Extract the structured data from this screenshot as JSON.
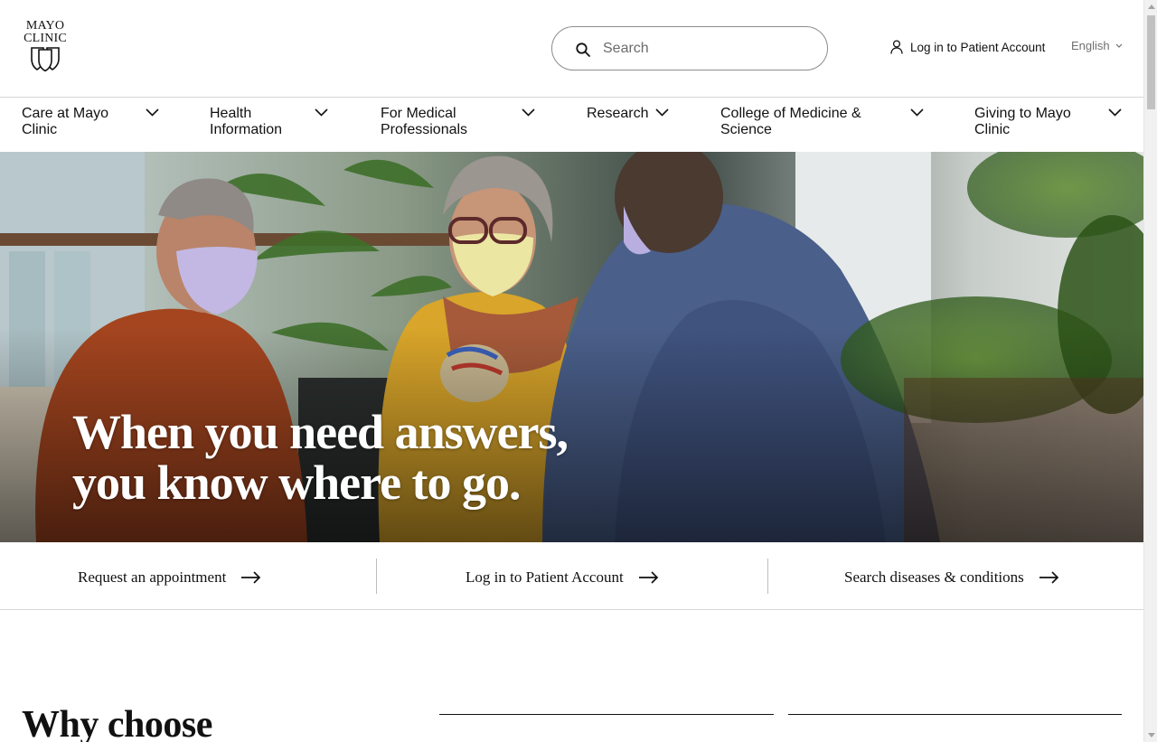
{
  "brand": {
    "line1": "MAYO",
    "line2": "CLINIC"
  },
  "search": {
    "placeholder": "Search"
  },
  "header": {
    "login_label": "Log in to Patient Account",
    "language": "English"
  },
  "nav": {
    "items": [
      {
        "line1": "Care at Mayo",
        "line2": "Clinic"
      },
      {
        "line1": "Health",
        "line2": "Information"
      },
      {
        "line1": "For Medical",
        "line2": "Professionals"
      },
      {
        "line1": "Research",
        "line2": ""
      },
      {
        "line1": "College of Medicine &",
        "line2": "Science"
      },
      {
        "line1": "Giving to Mayo",
        "line2": "Clinic"
      }
    ]
  },
  "hero": {
    "title_line1": "When you need answers,",
    "title_line2": "you know where to go."
  },
  "quick_links": [
    {
      "label": "Request an appointment"
    },
    {
      "label": "Log in to Patient Account"
    },
    {
      "label": "Search diseases & conditions"
    }
  ],
  "section": {
    "heading": "Why choose"
  },
  "icons": {
    "search": "search-icon",
    "user": "user-icon",
    "chevron": "chevron-down-icon",
    "arrow": "arrow-right-icon",
    "shield": "mayo-shield-icon"
  },
  "colors": {
    "text": "#080808",
    "border": "#d6d6d6",
    "muted": "#6f6f6f"
  }
}
